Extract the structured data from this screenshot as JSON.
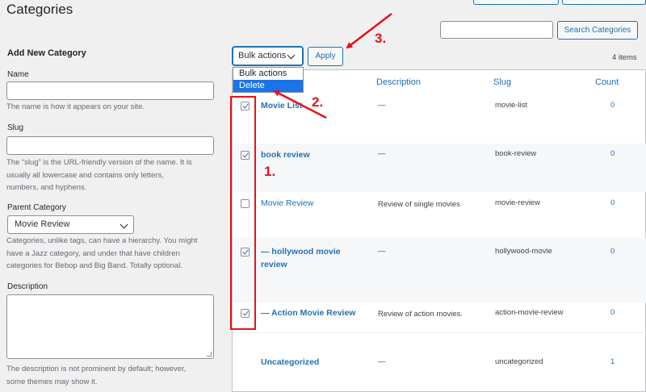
{
  "page": {
    "title": "Categories"
  },
  "search": {
    "button_label": "Search Categories",
    "value": ""
  },
  "form": {
    "heading": "Add New Category",
    "name_label": "Name",
    "name_hint": "The name is how it appears on your site.",
    "slug_label": "Slug",
    "slug_hint_1": "The “slug” is the URL-friendly version of the name. It is",
    "slug_hint_2": "usually all lowercase and contains only letters,",
    "slug_hint_3": "numbers, and hyphens.",
    "parent_label": "Parent Category",
    "parent_value": "Movie Review",
    "parent_hint_1": "Categories, unlike tags, can have a hierarchy. You might",
    "parent_hint_2": "have a Jazz category, and under that have children",
    "parent_hint_3": "categories for Bebop and Big Band. Totally optional.",
    "description_label": "Description",
    "description_hint_1": "The description is not prominent by default; however,",
    "description_hint_2": "some themes may show it."
  },
  "bulk": {
    "selected": "Bulk actions",
    "options": [
      "Bulk actions",
      "Delete"
    ],
    "highlighted": "Delete",
    "apply_label": "Apply",
    "items_count": "4 items"
  },
  "table": {
    "headers": {
      "description": "Description",
      "slug": "Slug",
      "count": "Count"
    },
    "rows": [
      {
        "name": "Movie List",
        "description": "—",
        "slug": "movie-list",
        "count": "0",
        "checked": true
      },
      {
        "name": "book review",
        "description": "—",
        "slug": "book-review",
        "count": "0",
        "checked": true
      },
      {
        "name": "Movie Review",
        "description": "Review of single movies",
        "slug": "movie-review",
        "count": "0",
        "checked": false
      },
      {
        "name_line1": "— hollywood movie",
        "name_line2": "review",
        "description": "—",
        "slug": "hollywood-movie",
        "count": "0",
        "checked": true
      },
      {
        "name": "— Action Movie Review",
        "description": "Review of action movies.",
        "slug": "action-movie-review",
        "count": "0",
        "checked": true
      },
      {
        "name": "Uncategorized",
        "description": "—",
        "slug": "uncategorized",
        "count": "1"
      }
    ]
  },
  "annotations": {
    "step1": "1.",
    "step2": "2.",
    "step3": "3."
  },
  "colors": {
    "accent": "#2271b1",
    "annotation_red": "#e8111a",
    "highlight": "#1a73e8"
  }
}
